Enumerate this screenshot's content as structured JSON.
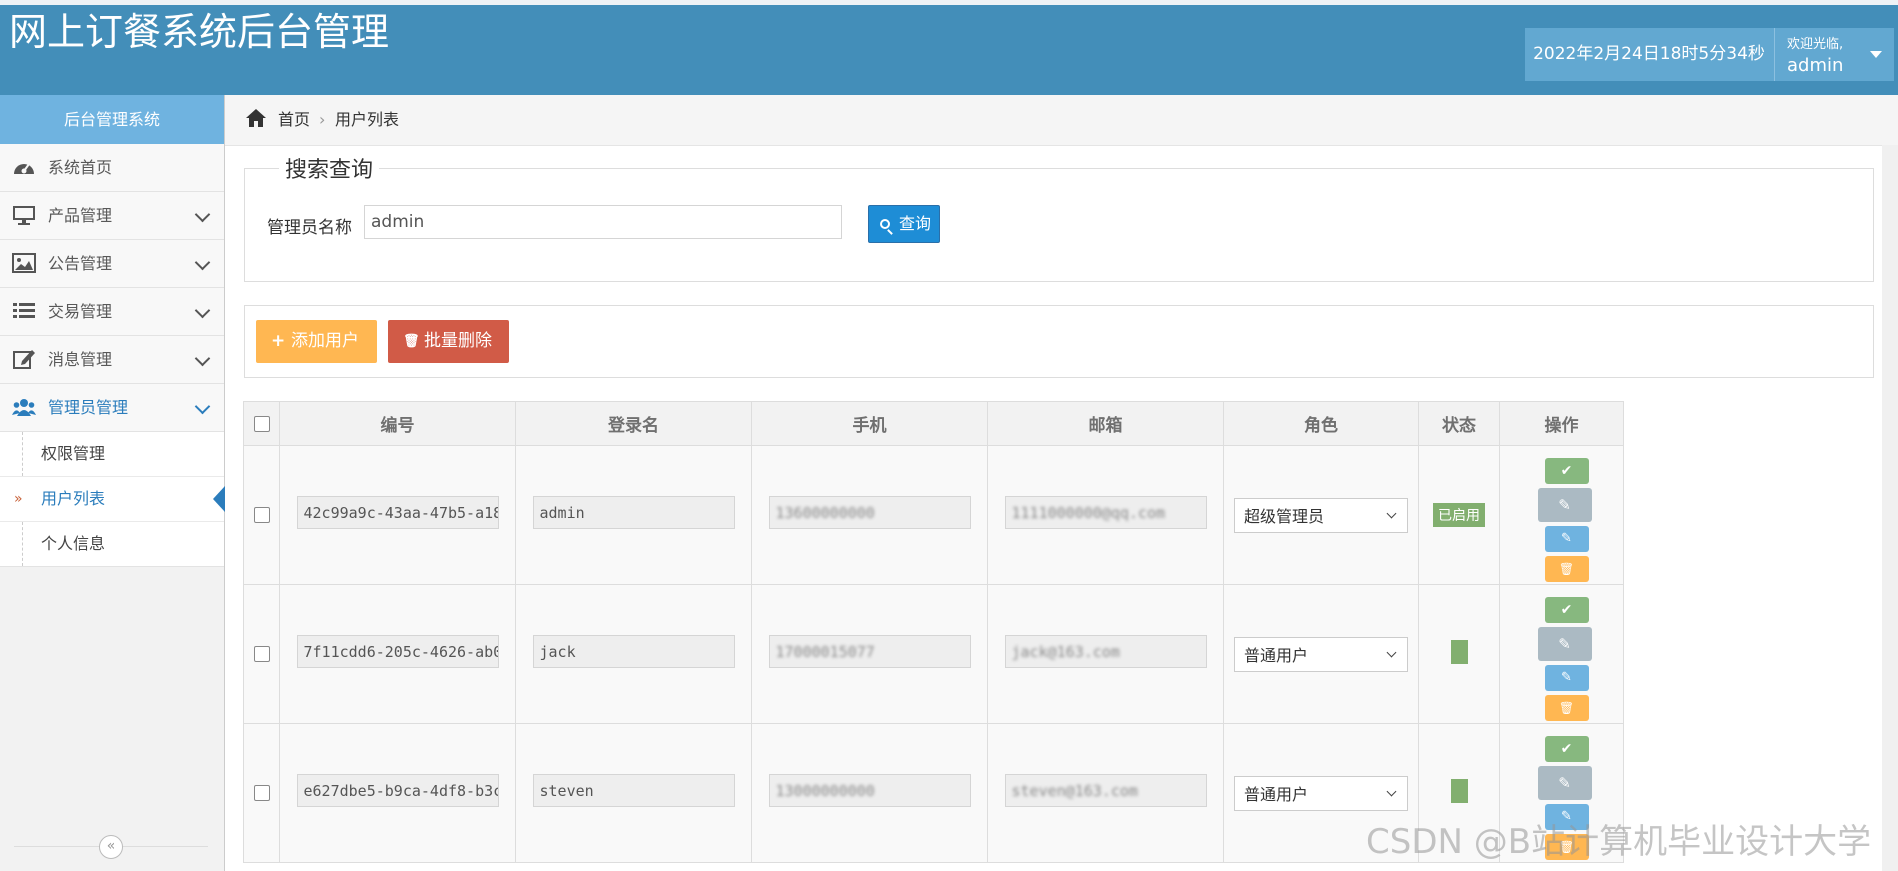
{
  "header": {
    "title": "网上订餐系统后台管理",
    "datetime": "2022年2月24日18时5分34秒",
    "welcome": "欢迎光临,",
    "username": "admin"
  },
  "sidebar": {
    "title": "后台管理系统",
    "items": [
      {
        "label": "系统首页",
        "icon": "dashboard-icon"
      },
      {
        "label": "产品管理",
        "icon": "desktop-icon"
      },
      {
        "label": "公告管理",
        "icon": "picture-icon"
      },
      {
        "label": "交易管理",
        "icon": "list-icon"
      },
      {
        "label": "消息管理",
        "icon": "edit-icon"
      },
      {
        "label": "管理员管理",
        "icon": "users-icon"
      }
    ],
    "subitems": [
      {
        "label": "权限管理"
      },
      {
        "label": "用户列表"
      },
      {
        "label": "个人信息"
      }
    ],
    "collapse": "«"
  },
  "breadcrumb": {
    "home": "首页",
    "separator": "›",
    "current": "用户列表"
  },
  "search": {
    "legend": "搜索查询",
    "label": "管理员名称",
    "value": "admin",
    "button": "查询"
  },
  "actions": {
    "add": "添加用户",
    "add_icon": "+",
    "delete": "批量删除",
    "delete_icon": "🗑"
  },
  "table": {
    "headers": [
      "编号",
      "登录名",
      "手机",
      "邮箱",
      "角色",
      "状态",
      "操作"
    ],
    "rows": [
      {
        "id": "42c99a9c-43aa-47b5-a18",
        "login": "admin",
        "phone": "13600000000",
        "email": "1111000000@qq.com",
        "role": "超级管理员",
        "status": "已启用"
      },
      {
        "id": "7f11cdd6-205c-4626-ab0",
        "login": "jack",
        "phone": "17000015077",
        "email": "jack@163.com",
        "role": "普通用户",
        "status": ""
      },
      {
        "id": "e627dbe5-b9ca-4df8-b3c",
        "login": "steven",
        "phone": "13000000000",
        "email": "steven@163.com",
        "role": "普通用户",
        "status": ""
      }
    ]
  },
  "watermark": "CSDN @B站计算机毕业设计大学",
  "colors": {
    "header": "#438eb9",
    "accent": "#2b7dbc",
    "query": "#1e8dd6",
    "add": "#ffb752",
    "delete": "#d15b47",
    "status": "#82af6f"
  }
}
